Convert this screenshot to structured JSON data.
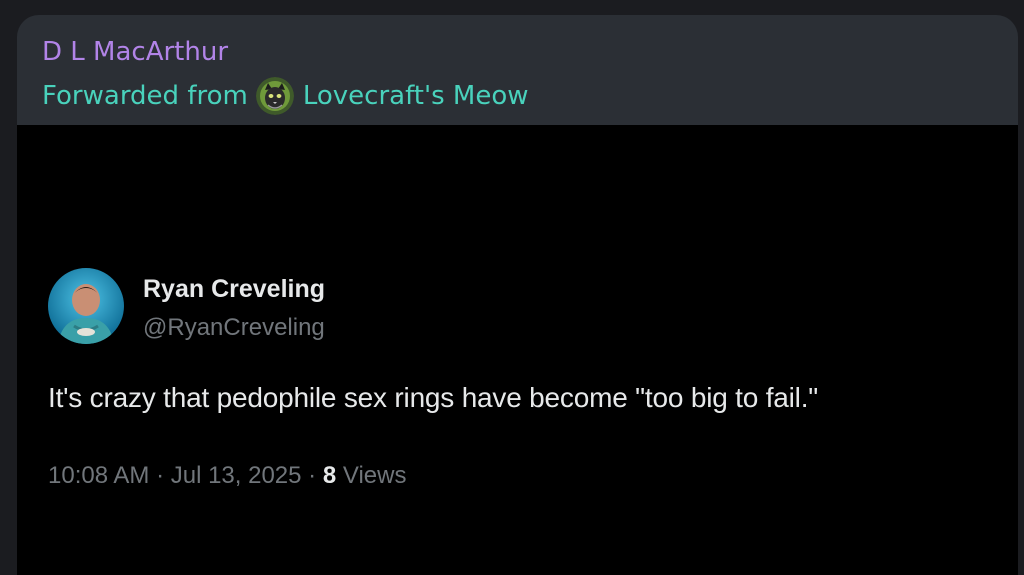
{
  "message": {
    "sender_name": "D L MacArthur",
    "forwarded_prefix": "Forwarded from",
    "forwarded_channel": "Lovecraft's Meow",
    "channel_avatar_icon": "cat-avatar-icon"
  },
  "tweet": {
    "author_name": "Ryan Creveling",
    "author_handle": "@RyanCreveling",
    "avatar_icon": "profile-photo-avatar",
    "text": "It's crazy that pedophile sex rings have become \"too big to fail.\"",
    "time": "10:08 AM",
    "separator": " · ",
    "date": "Jul 13, 2025",
    "views_count": "8",
    "views_label": " Views"
  },
  "colors": {
    "sender": "#b284e8",
    "forwarded": "#49d2bc",
    "bubble": "#2b2f35",
    "media_bg": "#000000",
    "tweet_text": "#e7e9ea",
    "tweet_secondary": "#71767b"
  }
}
